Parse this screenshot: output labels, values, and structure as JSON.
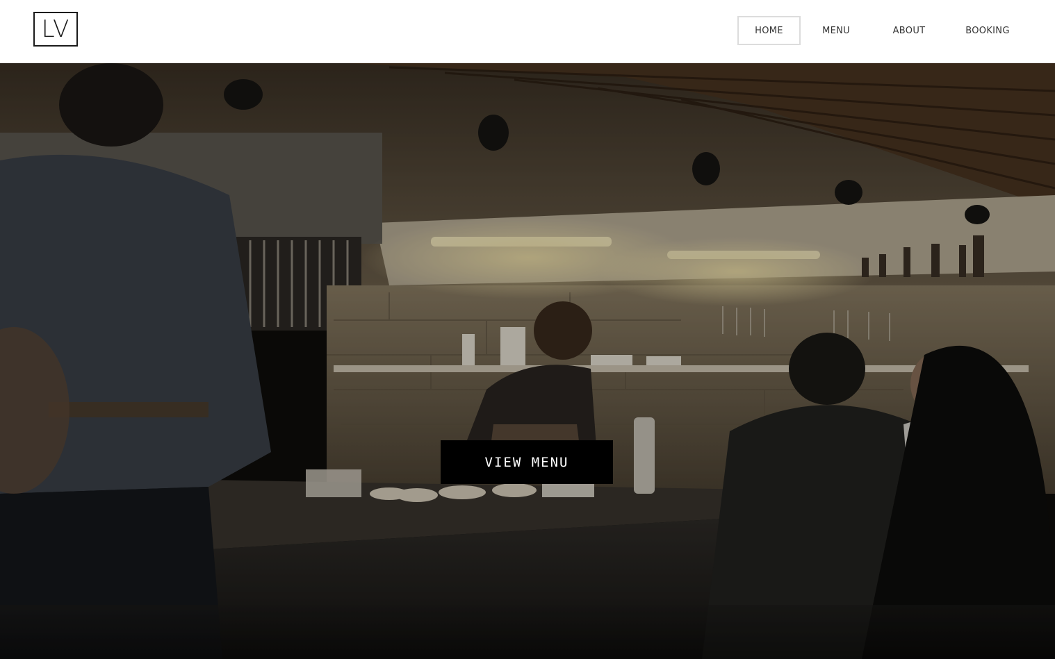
{
  "header": {
    "logo_text": "LV",
    "nav": [
      {
        "label": "HOME",
        "active": true
      },
      {
        "label": "MENU",
        "active": false
      },
      {
        "label": "ABOUT",
        "active": false
      },
      {
        "label": "BOOKING",
        "active": false
      }
    ]
  },
  "hero": {
    "image": "restaurant-open-kitchen-photo",
    "cta_label": "VIEW MENU"
  },
  "colors": {
    "header_bg": "#ffffff",
    "nav_text": "#333333",
    "active_border": "#dcdcdc",
    "cta_bg": "#000000",
    "cta_text": "#ffffff"
  }
}
